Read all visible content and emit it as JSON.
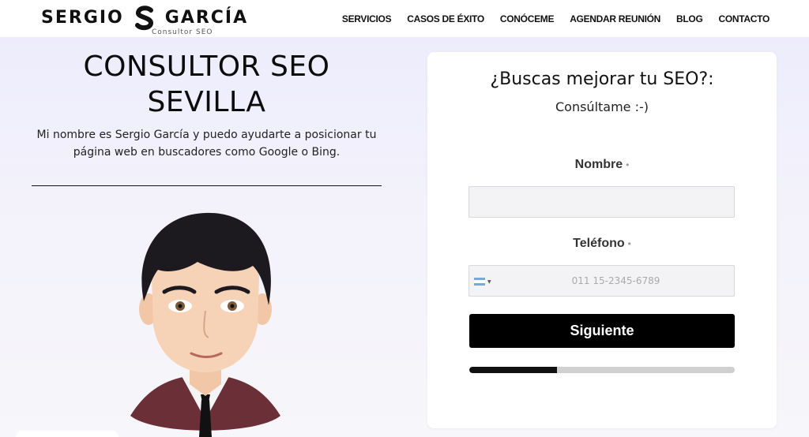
{
  "brand": {
    "first": "SERGIO",
    "second": "GARCÍA",
    "tagline": "Consultor SEO"
  },
  "nav": {
    "items": [
      "SERVICIOS",
      "CASOS DE ÉXITO",
      "CONÓCEME",
      "AGENDAR REUNIÓN",
      "BLOG",
      "CONTACTO"
    ]
  },
  "hero": {
    "title_line1": "CONSULTOR SEO",
    "title_line2": "SEVILLA",
    "description": "Mi nombre es Sergio García y puedo ayudarte a posicionar tu página web en buscadores como Google o Bing."
  },
  "form": {
    "title": "¿Buscas mejorar tu SEO?:",
    "subtitle": "Consúltame :-)",
    "name_label": "Nombre",
    "phone_label": "Teléfono",
    "required_mark": "•",
    "name_value": "",
    "phone_placeholder": "011 15-2345-6789",
    "country_flag": "argentina-flag-icon",
    "submit_label": "Siguiente",
    "progress": 0.33
  }
}
